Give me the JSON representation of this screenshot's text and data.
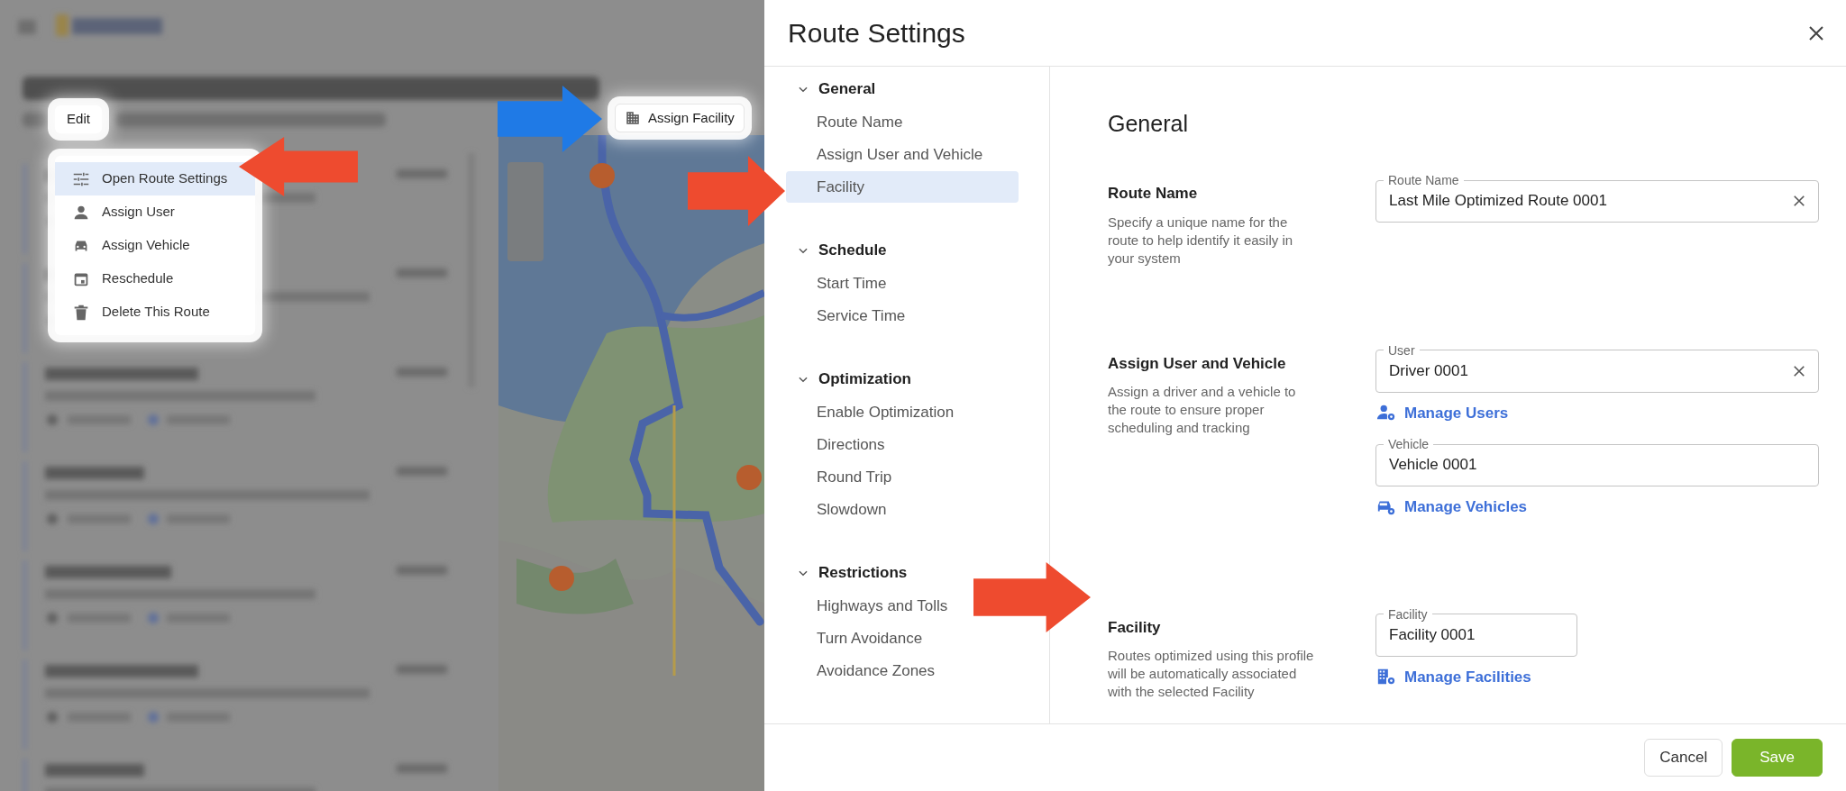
{
  "background": {
    "edit_tab": {
      "label": "Edit"
    },
    "edit_menu": [
      {
        "label": "Open Route Settings",
        "selected": true
      },
      {
        "label": "Assign User",
        "selected": false
      },
      {
        "label": "Assign Vehicle",
        "selected": false
      },
      {
        "label": "Reschedule",
        "selected": false
      },
      {
        "label": "Delete This Route",
        "selected": false
      }
    ],
    "toolbar_button": {
      "label": "Assign Facility"
    }
  },
  "dialog": {
    "title": "Route Settings",
    "nav": [
      {
        "heading": "General",
        "expanded": true,
        "items": [
          {
            "label": "Route Name",
            "selected": false
          },
          {
            "label": "Assign User and Vehicle",
            "selected": false
          },
          {
            "label": "Facility",
            "selected": true
          }
        ]
      },
      {
        "heading": "Schedule",
        "expanded": true,
        "items": [
          {
            "label": "Start Time",
            "selected": false
          },
          {
            "label": "Service Time",
            "selected": false
          }
        ]
      },
      {
        "heading": "Optimization",
        "expanded": true,
        "items": [
          {
            "label": "Enable Optimization",
            "selected": false
          },
          {
            "label": "Directions",
            "selected": false
          },
          {
            "label": "Round Trip",
            "selected": false
          },
          {
            "label": "Slowdown",
            "selected": false
          }
        ]
      },
      {
        "heading": "Restrictions",
        "expanded": true,
        "items": [
          {
            "label": "Highways and Tolls",
            "selected": false
          },
          {
            "label": "Turn Avoidance",
            "selected": false
          },
          {
            "label": "Avoidance Zones",
            "selected": false
          }
        ]
      }
    ],
    "content": {
      "heading": "General",
      "sections": [
        {
          "title": "Route Name",
          "description": "Specify a unique name for the route to help identify it easily in your system",
          "controls": [
            {
              "kind": "field",
              "label": "Route Name",
              "value": "Last Mile Optimized Route 0001",
              "clearable": true
            }
          ]
        },
        {
          "title": "Assign User and Vehicle",
          "description": "Assign a driver and a vehicle to the route to ensure proper scheduling and tracking",
          "controls": [
            {
              "kind": "field",
              "label": "User",
              "value": "Driver 0001",
              "clearable": true
            },
            {
              "kind": "link",
              "label": "Manage Users"
            },
            {
              "kind": "field",
              "label": "Vehicle",
              "value": "Vehicle 0001",
              "clearable": false
            },
            {
              "kind": "link",
              "label": "Manage Vehicles"
            }
          ]
        },
        {
          "title": "Facility",
          "description": "Routes optimized using this profile will be automatically associated with the selected Facility",
          "controls": [
            {
              "kind": "field",
              "label": "Facility",
              "value": "Facility 0001",
              "clearable": false
            },
            {
              "kind": "link",
              "label": "Manage Facilities"
            }
          ]
        }
      ]
    },
    "buttons": [
      {
        "label": "Cancel",
        "kind": "secondary"
      },
      {
        "label": "Save",
        "kind": "primary"
      }
    ]
  },
  "annotations": [
    {
      "color": "#ee4b2f"
    },
    {
      "color": "#1f7ae6"
    },
    {
      "color": "#ee4b2f"
    },
    {
      "color": "#ee4b2f"
    }
  ]
}
